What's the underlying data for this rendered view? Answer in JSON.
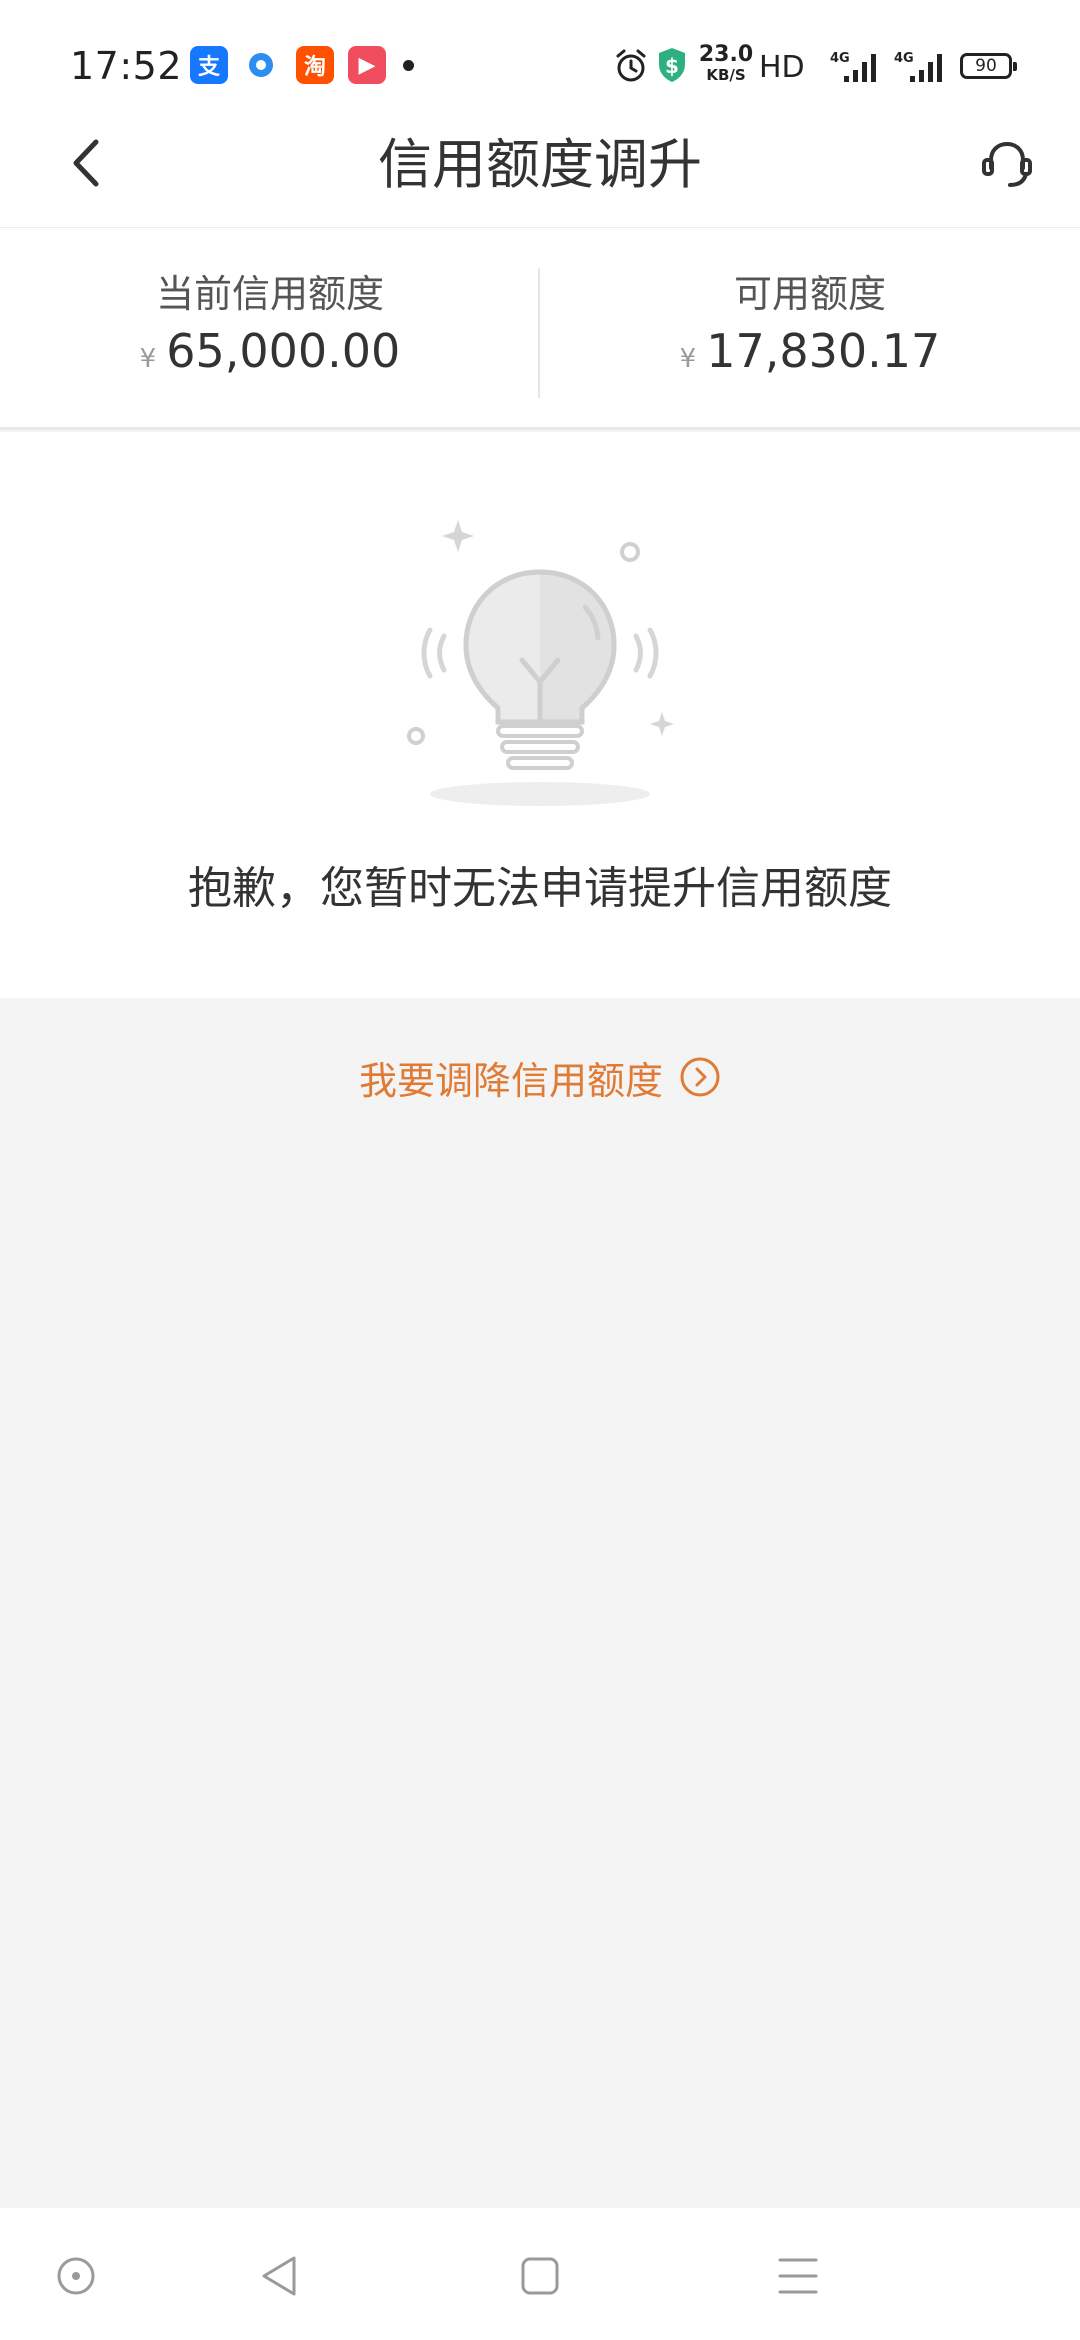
{
  "status_bar": {
    "time": "17:52",
    "app_icons": [
      {
        "name": "alipay-icon",
        "glyph": "支",
        "color": "#1677ff"
      },
      {
        "name": "qq-browser-icon",
        "glyph": "",
        "color": "#2b8ef0"
      },
      {
        "name": "taobao-icon",
        "glyph": "淘",
        "color": "#ff5000"
      },
      {
        "name": "video-app-icon",
        "glyph": "▶",
        "color": "#f04d5e"
      }
    ],
    "net_speed_value": "23.0",
    "net_speed_unit": "KB/S",
    "hd_label": "HD",
    "network_1": "4G",
    "network_2": "4G",
    "battery": "90"
  },
  "nav": {
    "title": "信用额度调升",
    "back_icon": "chevron-left-icon",
    "service_icon": "headset-icon"
  },
  "credit": {
    "currency_symbol": "¥",
    "current_label": "当前信用额度",
    "current_amount": "65,000.00",
    "available_label": "可用额度",
    "available_amount": "17,830.17"
  },
  "notice": {
    "icon": "lightbulb-icon",
    "message": "抱歉，您暂时无法申请提升信用额度"
  },
  "reduce_link": {
    "label": "我要调降信用额度",
    "icon": "circle-arrow-right-icon"
  },
  "colors": {
    "accent": "#e07b35",
    "background": "#f4f4f4",
    "surface": "#ffffff",
    "text_primary": "#333333"
  }
}
